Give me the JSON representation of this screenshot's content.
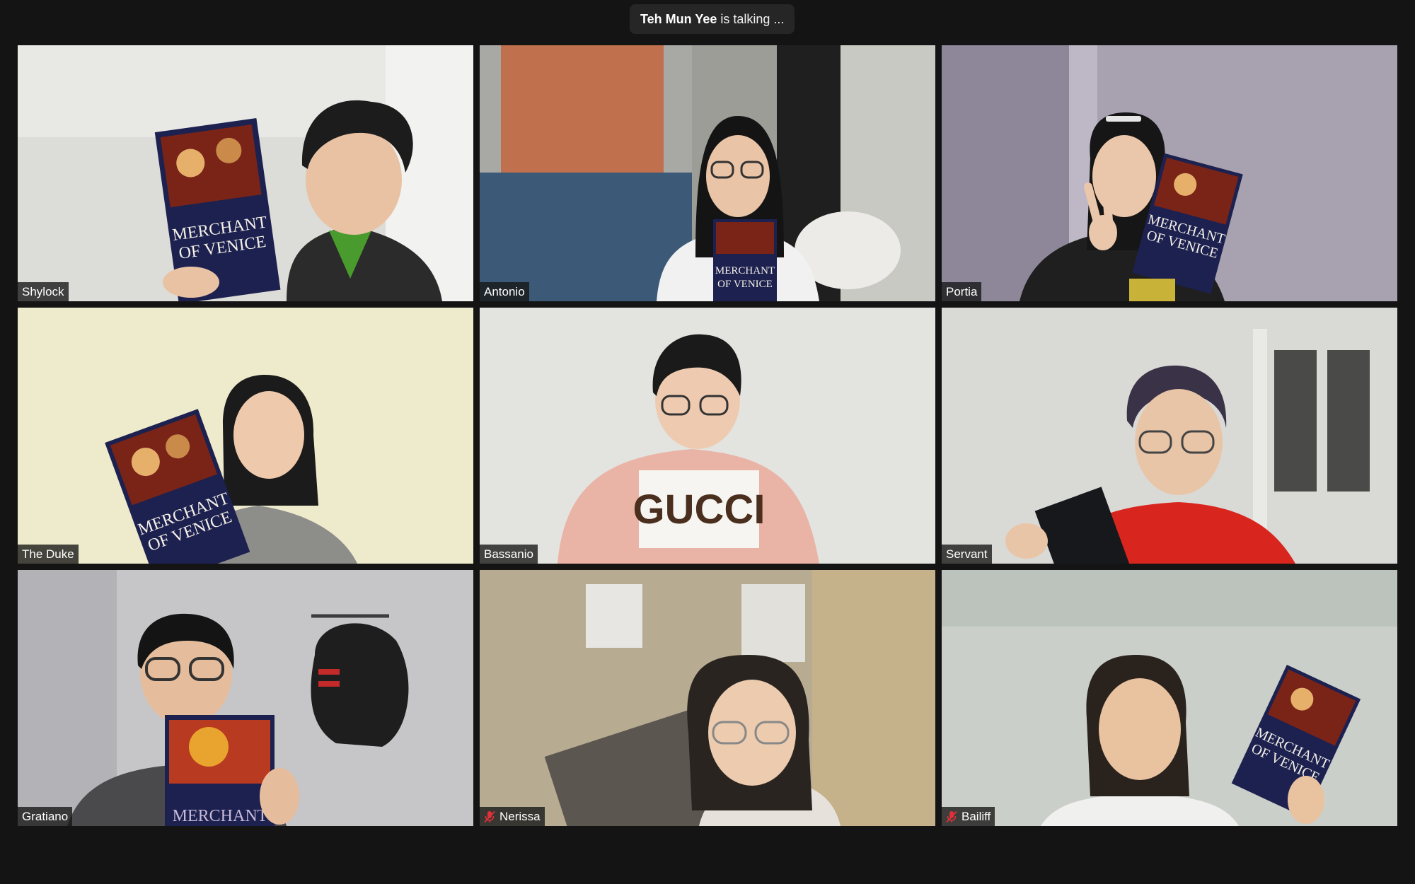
{
  "status": {
    "speaker": "Teh Mun Yee",
    "suffix": "is talking ..."
  },
  "participants": [
    {
      "name": "Shylock",
      "muted": false
    },
    {
      "name": "Antonio",
      "muted": false
    },
    {
      "name": "Portia",
      "muted": false
    },
    {
      "name": "The Duke",
      "muted": false
    },
    {
      "name": "Bassanio",
      "muted": false
    },
    {
      "name": "Servant",
      "muted": false
    },
    {
      "name": "Gratiano",
      "muted": false
    },
    {
      "name": "Nerissa",
      "muted": true
    },
    {
      "name": "Bailiff",
      "muted": true
    }
  ],
  "book": {
    "line1": "MERCHANT",
    "line2": "OF VENICE"
  },
  "shirt_text": "GUCCI",
  "colors": {
    "background": "#141414",
    "mute": "#e0303a",
    "book_cover": "#1d2150"
  },
  "icons": {
    "mute": "microphone-muted-icon"
  }
}
